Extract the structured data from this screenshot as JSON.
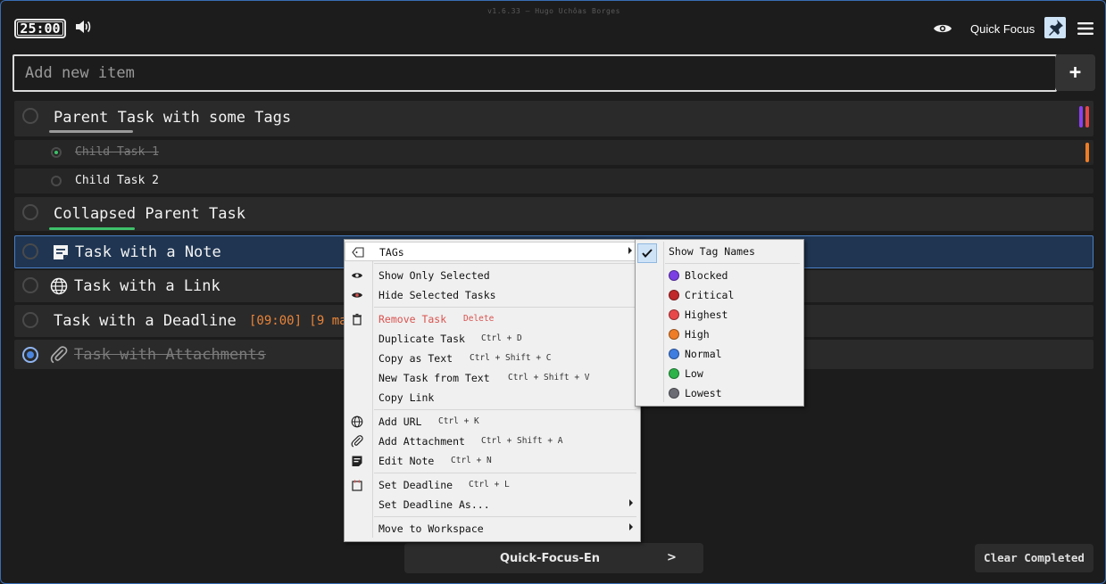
{
  "app": {
    "version": "v1.6.33 — Hugo Uchôas Borges",
    "timer": "25:00",
    "quick_focus_label": "Quick Focus"
  },
  "input": {
    "placeholder": "Add new item",
    "add_label": "+"
  },
  "tasks": [
    {
      "text": "Parent Task with some Tags",
      "done": false
    },
    {
      "text": "Child Task 1",
      "done": true
    },
    {
      "text": "Child Task 2",
      "done": false
    },
    {
      "text": "Collapsed Parent Task",
      "done": false
    },
    {
      "text": "Task with a Note",
      "done": false,
      "icon": "note-icon"
    },
    {
      "text": "Task with a Link",
      "done": false,
      "icon": "globe-icon"
    },
    {
      "text": "Task with a Deadline",
      "deadline": "[09:00] [9 ma",
      "done": false
    },
    {
      "text": "Task with Attachments",
      "done": true,
      "icon": "paperclip-icon"
    }
  ],
  "context_menu": {
    "tags": "TAGs",
    "show_only_selected": "Show Only Selected",
    "hide_selected": "Hide Selected Tasks",
    "remove_task": "Remove Task",
    "remove_sc": "Delete",
    "duplicate": "Duplicate Task",
    "duplicate_sc": "Ctrl + D",
    "copy_text": "Copy as Text",
    "copy_text_sc": "Ctrl + Shift + C",
    "new_from_text": "New Task from Text",
    "new_from_text_sc": "Ctrl + Shift + V",
    "copy_link": "Copy Link",
    "add_url": "Add URL",
    "add_url_sc": "Ctrl + K",
    "add_attachment": "Add Attachment",
    "add_attachment_sc": "Ctrl + Shift + A",
    "edit_note": "Edit Note",
    "edit_note_sc": "Ctrl + N",
    "set_deadline": "Set Deadline",
    "set_deadline_sc": "Ctrl + L",
    "set_deadline_as": "Set Deadline As...",
    "move_workspace": "Move to Workspace"
  },
  "tags_submenu": {
    "show_tag_names": "Show Tag Names",
    "show_tag_names_checked": true,
    "tags": [
      {
        "name": "Blocked",
        "color": "#7b3fe4"
      },
      {
        "name": "Critical",
        "color": "#c0282a"
      },
      {
        "name": "Highest",
        "color": "#e8474a"
      },
      {
        "name": "High",
        "color": "#ef7d27"
      },
      {
        "name": "Normal",
        "color": "#3f7de0"
      },
      {
        "name": "Low",
        "color": "#2db34a"
      },
      {
        "name": "Lowest",
        "color": "#6b6b74"
      }
    ]
  },
  "colors": {
    "parent_underline": "#9a9a9a",
    "collapsed_underline": "#3ec16a",
    "tag_purple": "#8a3ff0",
    "tag_red": "#e8474a",
    "tag_orange": "#ef7d27",
    "deadline": "#e8843a",
    "selection": "#1f3552"
  },
  "footer": {
    "workspace": "Quick-Focus-En",
    "workspace_arrow": ">",
    "clear_completed": "Clear Completed"
  }
}
